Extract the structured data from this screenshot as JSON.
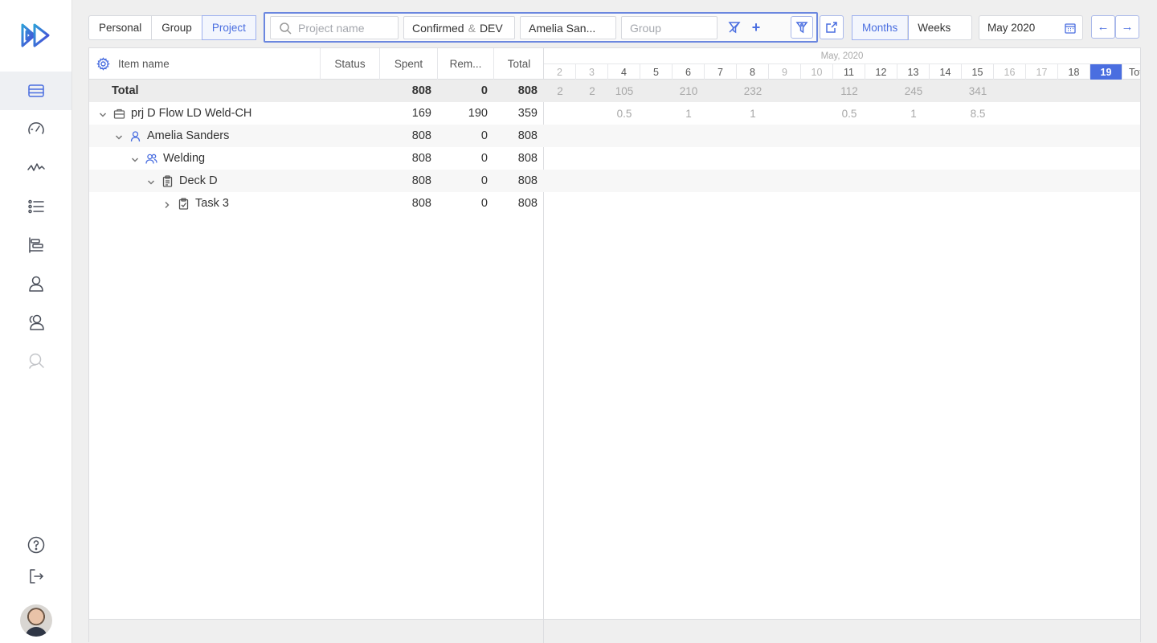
{
  "view_modes": [
    "Personal",
    "Group",
    "Project"
  ],
  "active_view_mode": "Project",
  "filters": {
    "project_placeholder": "Project name",
    "status_value_a": "Confirmed",
    "status_amp": "&",
    "status_value_b": "DEV",
    "person_value": "Amelia San...",
    "group_placeholder": "Group",
    "plus_label": "+"
  },
  "period_modes": [
    "Months",
    "Weeks"
  ],
  "active_period_mode": "Months",
  "date_value": "May 2020",
  "nav": {
    "prev": "←",
    "next": "→"
  },
  "columns": {
    "item_name": "Item name",
    "status": "Status",
    "spent": "Spent",
    "remaining": "Rem...",
    "total": "Total"
  },
  "timeline": {
    "month_label": "May, 2020",
    "days": [
      "2",
      "3",
      "4",
      "5",
      "6",
      "7",
      "8",
      "9",
      "10",
      "11",
      "12",
      "13",
      "14",
      "15",
      "16",
      "17",
      "18",
      "19"
    ],
    "weekend_days": [
      "2",
      "3",
      "9",
      "10",
      "16",
      "17"
    ],
    "today": "19",
    "total_label": "Tot"
  },
  "rows": [
    {
      "name": "Total",
      "kind": "total",
      "level": 0,
      "icon": "",
      "spent": "808",
      "remaining": "0",
      "total": "808",
      "timeline": {
        "2": "2",
        "3": "2",
        "4": "105",
        "6": "210",
        "8": "232",
        "11": "112",
        "13": "245",
        "15": "341"
      }
    },
    {
      "name": "prj D Flow LD Weld-CH",
      "kind": "project",
      "level": 0,
      "icon": "briefcase-icon",
      "spent": "169",
      "remaining": "190",
      "total": "359",
      "timeline": {
        "4": "0.5",
        "6": "1",
        "8": "1",
        "11": "0.5",
        "13": "1",
        "15": "8.5"
      }
    },
    {
      "name": "Amelia Sanders",
      "kind": "person",
      "level": 1,
      "icon": "user-icon",
      "spent": "808",
      "remaining": "0",
      "total": "808",
      "timeline": {}
    },
    {
      "name": "Welding",
      "kind": "group",
      "level": 2,
      "icon": "users-icon",
      "spent": "808",
      "remaining": "0",
      "total": "808",
      "timeline": {}
    },
    {
      "name": "Deck D",
      "kind": "deck",
      "level": 3,
      "icon": "clipboard-icon",
      "spent": "808",
      "remaining": "0",
      "total": "808",
      "timeline": {}
    },
    {
      "name": "Task 3",
      "kind": "task",
      "level": 4,
      "icon": "task-icon",
      "spent": "808",
      "remaining": "0",
      "total": "808",
      "timeline": {},
      "collapsed": true
    }
  ],
  "sidebar_icons": [
    "table-icon",
    "speedometer-icon",
    "activity-icon",
    "list-icon",
    "gantt-icon",
    "user-icon",
    "users-icon",
    "search-user-icon"
  ],
  "sidebar_bottom_icons": [
    "help-icon",
    "logout-icon"
  ],
  "colors": {
    "accent": "#4a6ee0",
    "total_row": "#ededed"
  }
}
